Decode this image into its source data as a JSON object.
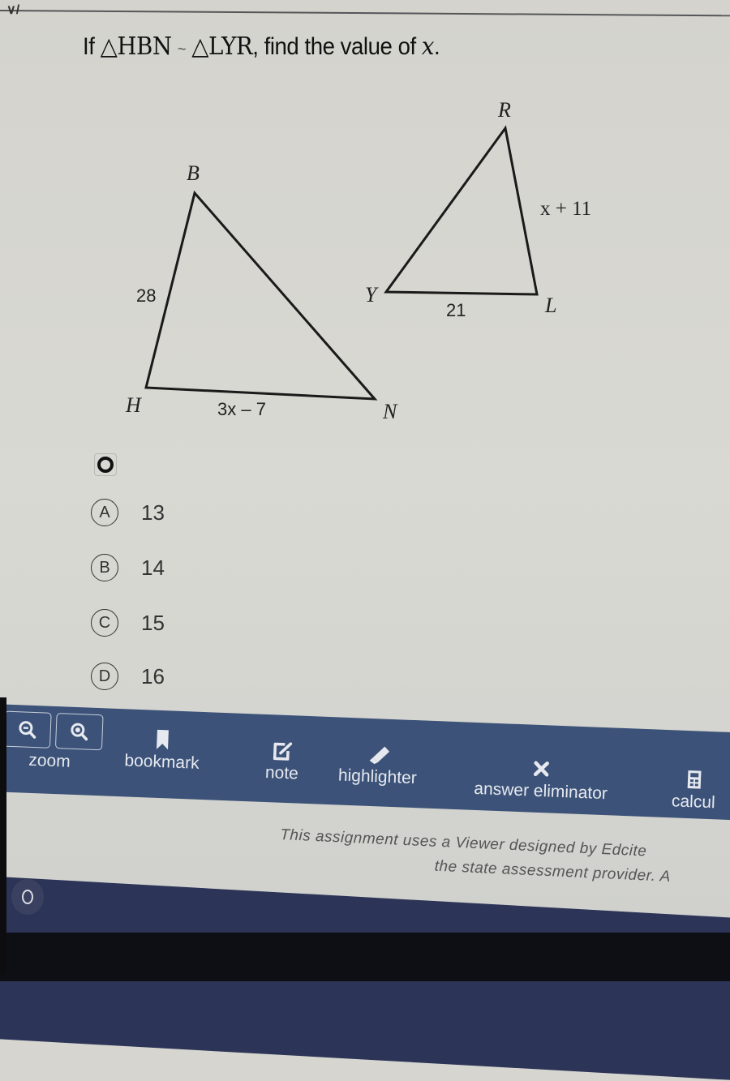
{
  "question": {
    "prefix": "If",
    "triangle1": "△HBN",
    "similar_symbol": "~",
    "triangle2": "△LYR",
    "suffix": ", find the value of",
    "variable": "x",
    "end": "."
  },
  "top_fragment": "∨/",
  "figure": {
    "triangle_hbn": {
      "vertices": {
        "H": "H",
        "B": "B",
        "N": "N"
      },
      "side_hb": "28",
      "side_hn": "3x – 7"
    },
    "triangle_lyr": {
      "vertices": {
        "L": "L",
        "Y": "Y",
        "R": "R"
      },
      "side_yl": "21",
      "side_rl": "x + 11"
    }
  },
  "options": [
    {
      "letter": "A",
      "value": "13"
    },
    {
      "letter": "B",
      "value": "14"
    },
    {
      "letter": "C",
      "value": "15"
    },
    {
      "letter": "D",
      "value": "16"
    }
  ],
  "toolbar": {
    "zoom_label": "zoom",
    "bookmark_label": "bookmark",
    "note_label": "note",
    "highlighter_label": "highlighter",
    "answer_eliminator_label": "answer eliminator",
    "calculator_label": "calcul"
  },
  "footer": {
    "line1": "This assignment uses a Viewer designed by Edcite",
    "line2": "the state assessment provider. A"
  }
}
